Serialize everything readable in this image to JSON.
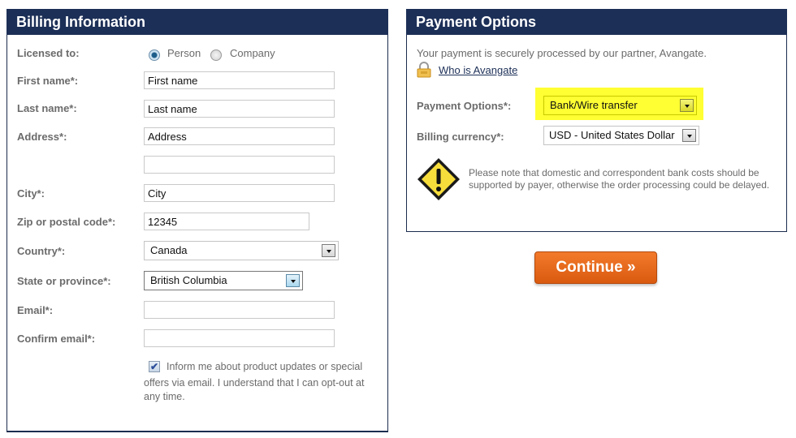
{
  "billing": {
    "title": "Billing Information",
    "licensed_to": {
      "label": "Licensed to:",
      "options": [
        {
          "label": "Person",
          "selected": true
        },
        {
          "label": "Company",
          "selected": false
        }
      ]
    },
    "first_name": {
      "label": "First name*:",
      "value": "First name"
    },
    "last_name": {
      "label": "Last name*:",
      "value": "Last name"
    },
    "address": {
      "label": "Address*:",
      "value": "Address",
      "line2_value": ""
    },
    "city": {
      "label": "City*:",
      "value": "City"
    },
    "zip": {
      "label": "Zip or postal code*:",
      "value": "12345"
    },
    "country": {
      "label": "Country*:",
      "value": "Canada"
    },
    "state": {
      "label": "State or province*:",
      "value": "British Columbia"
    },
    "email": {
      "label": "Email*:",
      "value": ""
    },
    "confirm_email": {
      "label": "Confirm email*:",
      "value": ""
    },
    "optin": {
      "checked": true,
      "check_glyph": "✔",
      "line1": "Inform me about product updates or special",
      "line2": "offers via email. I understand that I can opt-out at",
      "line3": "any time."
    }
  },
  "payment": {
    "title": "Payment Options",
    "secure_text": "Your payment is securely processed by our partner, Avangate.",
    "who_link": "Who is Avangate",
    "payment_option": {
      "label": "Payment Options*:",
      "value": "Bank/Wire transfer"
    },
    "currency": {
      "label": "Billing currency*:",
      "value": "USD - United States Dollar"
    },
    "note_line1": "Please note that domestic and correspondent bank costs should be",
    "note_line2": "supported by payer, otherwise the order processing could be delayed."
  },
  "continue_label": "Continue »",
  "colors": {
    "header_bg": "#1c2f57",
    "highlight": "#ffff33",
    "button_orange": "#e8661b"
  }
}
